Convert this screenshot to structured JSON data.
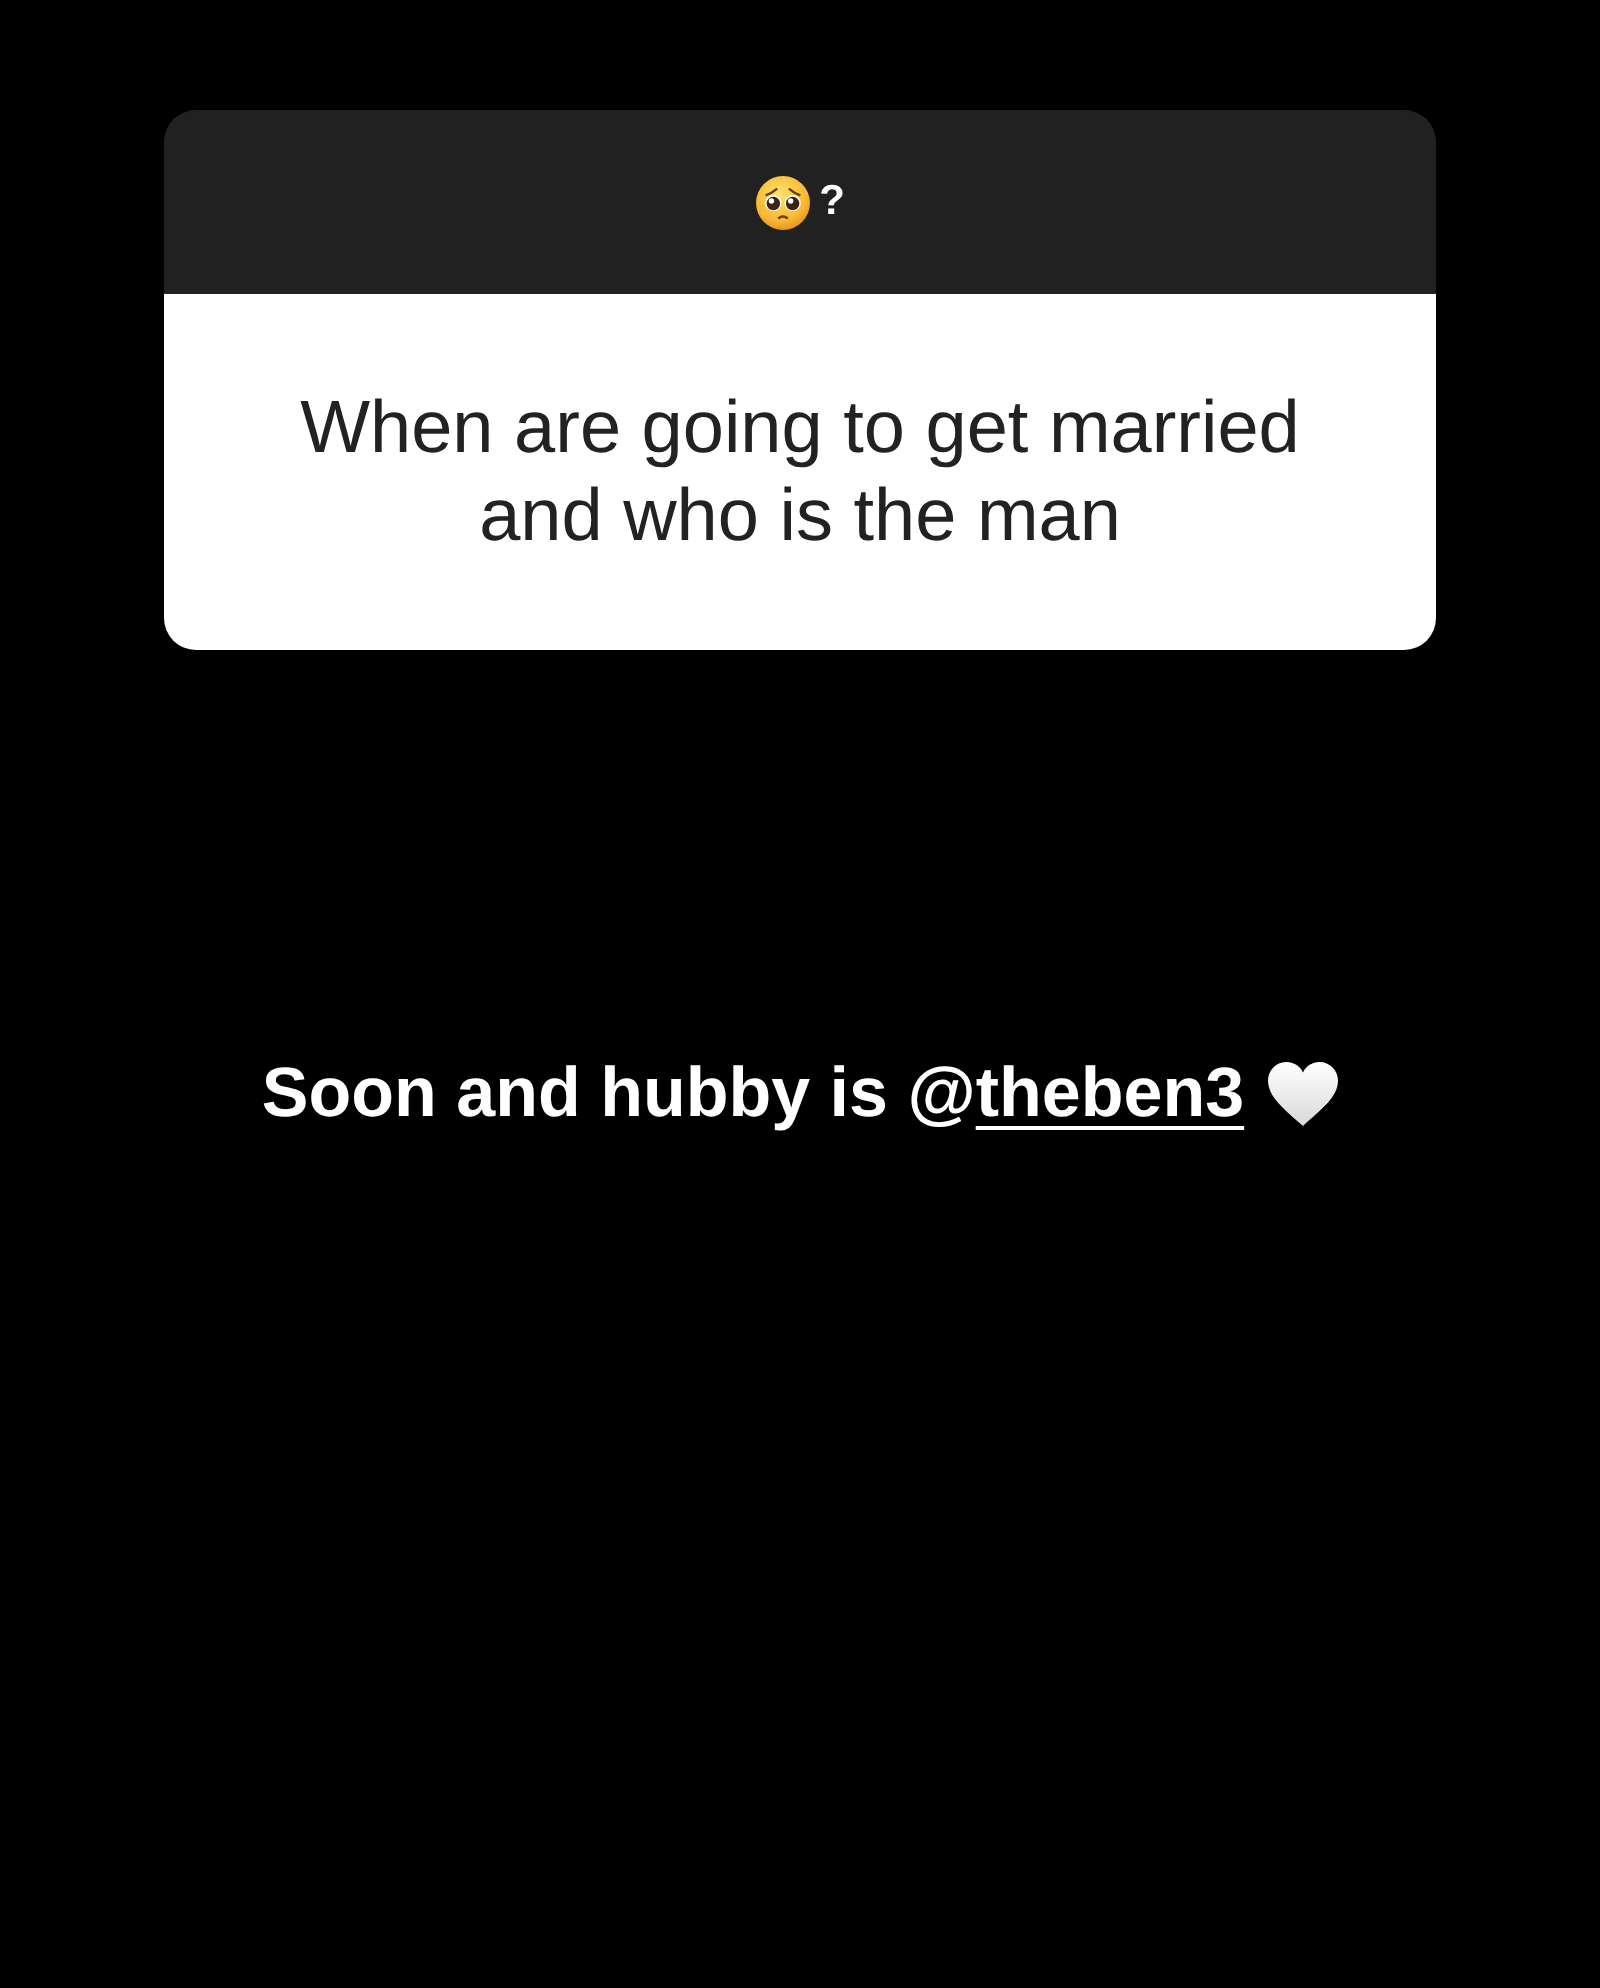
{
  "question_sticker": {
    "prompt": "?",
    "question": "When are going to get married and who is the man"
  },
  "reply": {
    "text": "Soon and hubby is",
    "mention": {
      "symbol": "@",
      "handle": "theben3"
    }
  }
}
